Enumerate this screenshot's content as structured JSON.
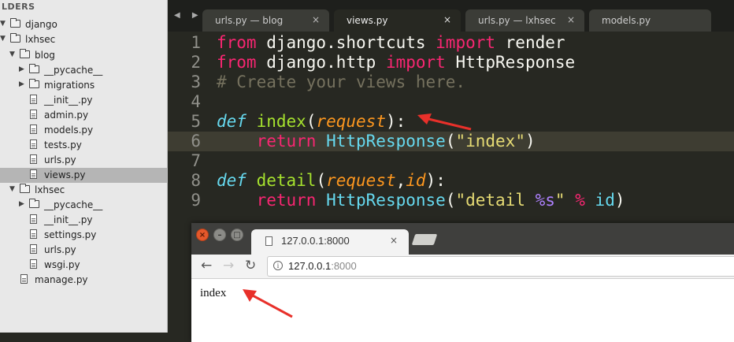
{
  "sidebar": {
    "header": "LDERS",
    "items": [
      {
        "label": "django",
        "level": 0,
        "kind": "folder",
        "expanded": true
      },
      {
        "label": "lxhsec",
        "level": 0,
        "kind": "folder",
        "expanded": true
      },
      {
        "label": "blog",
        "level": 1,
        "kind": "folder",
        "expanded": true
      },
      {
        "label": "__pycache__",
        "level": 2,
        "kind": "folder",
        "expanded": false
      },
      {
        "label": "migrations",
        "level": 2,
        "kind": "folder",
        "expanded": false
      },
      {
        "label": "__init__.py",
        "level": 2,
        "kind": "file"
      },
      {
        "label": "admin.py",
        "level": 2,
        "kind": "file"
      },
      {
        "label": "models.py",
        "level": 2,
        "kind": "file"
      },
      {
        "label": "tests.py",
        "level": 2,
        "kind": "file"
      },
      {
        "label": "urls.py",
        "level": 2,
        "kind": "file"
      },
      {
        "label": "views.py",
        "level": 2,
        "kind": "file",
        "selected": true
      },
      {
        "label": "lxhsec",
        "level": 1,
        "kind": "folder",
        "expanded": true
      },
      {
        "label": "__pycache__",
        "level": 2,
        "kind": "folder",
        "expanded": false
      },
      {
        "label": "__init__.py",
        "level": 2,
        "kind": "file"
      },
      {
        "label": "settings.py",
        "level": 2,
        "kind": "file"
      },
      {
        "label": "urls.py",
        "level": 2,
        "kind": "file"
      },
      {
        "label": "wsgi.py",
        "level": 2,
        "kind": "file"
      },
      {
        "label": "manage.py",
        "level": 1,
        "kind": "file"
      }
    ]
  },
  "editor": {
    "tabs": [
      {
        "label": "urls.py — blog",
        "active": false
      },
      {
        "label": "views.py",
        "active": true
      },
      {
        "label": "urls.py — lxhsec",
        "active": false
      },
      {
        "label": "models.py",
        "active": false
      }
    ],
    "tab_close": "×",
    "nav_arrows": "◀ ▶",
    "current_line": 6,
    "lines": [
      {
        "num": "1",
        "tokens": [
          [
            "kw",
            "from"
          ],
          [
            "wh",
            " django.shortcuts "
          ],
          [
            "kw",
            "import"
          ],
          [
            "wh",
            " render"
          ]
        ]
      },
      {
        "num": "2",
        "tokens": [
          [
            "kw",
            "from"
          ],
          [
            "wh",
            " django.http "
          ],
          [
            "kw",
            "import"
          ],
          [
            "wh",
            " HttpResponse"
          ]
        ]
      },
      {
        "num": "3",
        "tokens": [
          [
            "cm",
            "# Create your views here."
          ]
        ]
      },
      {
        "num": "4",
        "tokens": []
      },
      {
        "num": "5",
        "tokens": [
          [
            "st",
            "def"
          ],
          [
            "wh",
            " "
          ],
          [
            "fn",
            "index"
          ],
          [
            "wh",
            "("
          ],
          [
            "param",
            "request"
          ],
          [
            "wh",
            "):"
          ]
        ]
      },
      {
        "num": "6",
        "tokens": [
          [
            "wh",
            "    "
          ],
          [
            "kw",
            "return"
          ],
          [
            "wh",
            " "
          ],
          [
            "cls",
            "HttpResponse"
          ],
          [
            "wh",
            "("
          ],
          [
            "str",
            "\"index\""
          ],
          [
            "wh",
            ")"
          ]
        ]
      },
      {
        "num": "7",
        "tokens": []
      },
      {
        "num": "8",
        "tokens": [
          [
            "st",
            "def"
          ],
          [
            "wh",
            " "
          ],
          [
            "fn",
            "detail"
          ],
          [
            "wh",
            "("
          ],
          [
            "param",
            "request"
          ],
          [
            "wh",
            ","
          ],
          [
            "param",
            "id"
          ],
          [
            "wh",
            "):"
          ]
        ]
      },
      {
        "num": "9",
        "tokens": [
          [
            "wh",
            "    "
          ],
          [
            "kw",
            "return"
          ],
          [
            "wh",
            " "
          ],
          [
            "cls",
            "HttpResponse"
          ],
          [
            "wh",
            "("
          ],
          [
            "str",
            "\"detail "
          ],
          [
            "pl",
            "%s"
          ],
          [
            "str",
            "\""
          ],
          [
            "wh",
            " "
          ],
          [
            "kw",
            "%"
          ],
          [
            "wh",
            " "
          ],
          [
            "cls",
            "id"
          ],
          [
            "wh",
            ")"
          ]
        ]
      }
    ]
  },
  "browser": {
    "tab_title": "127.0.0.1:8000",
    "tab_close": "×",
    "url_host": "127.0.0.1",
    "url_port": ":8000",
    "back": "←",
    "forward": "→",
    "reload": "↻",
    "window_close": "×",
    "window_min": "–",
    "window_max": "□",
    "info_glyph": "i",
    "page_text": "index"
  },
  "colors": {
    "editor_bg": "#272822",
    "keyword": "#f92672",
    "function": "#a6e22e",
    "storage": "#66d9ef",
    "parameter": "#fd971f",
    "comment": "#75715e",
    "string": "#e6db74",
    "annotation_arrow": "#e8302a"
  },
  "icons": {
    "folder": "folder-icon",
    "file": "file-icon",
    "arrow": "red-annotation-arrow"
  }
}
